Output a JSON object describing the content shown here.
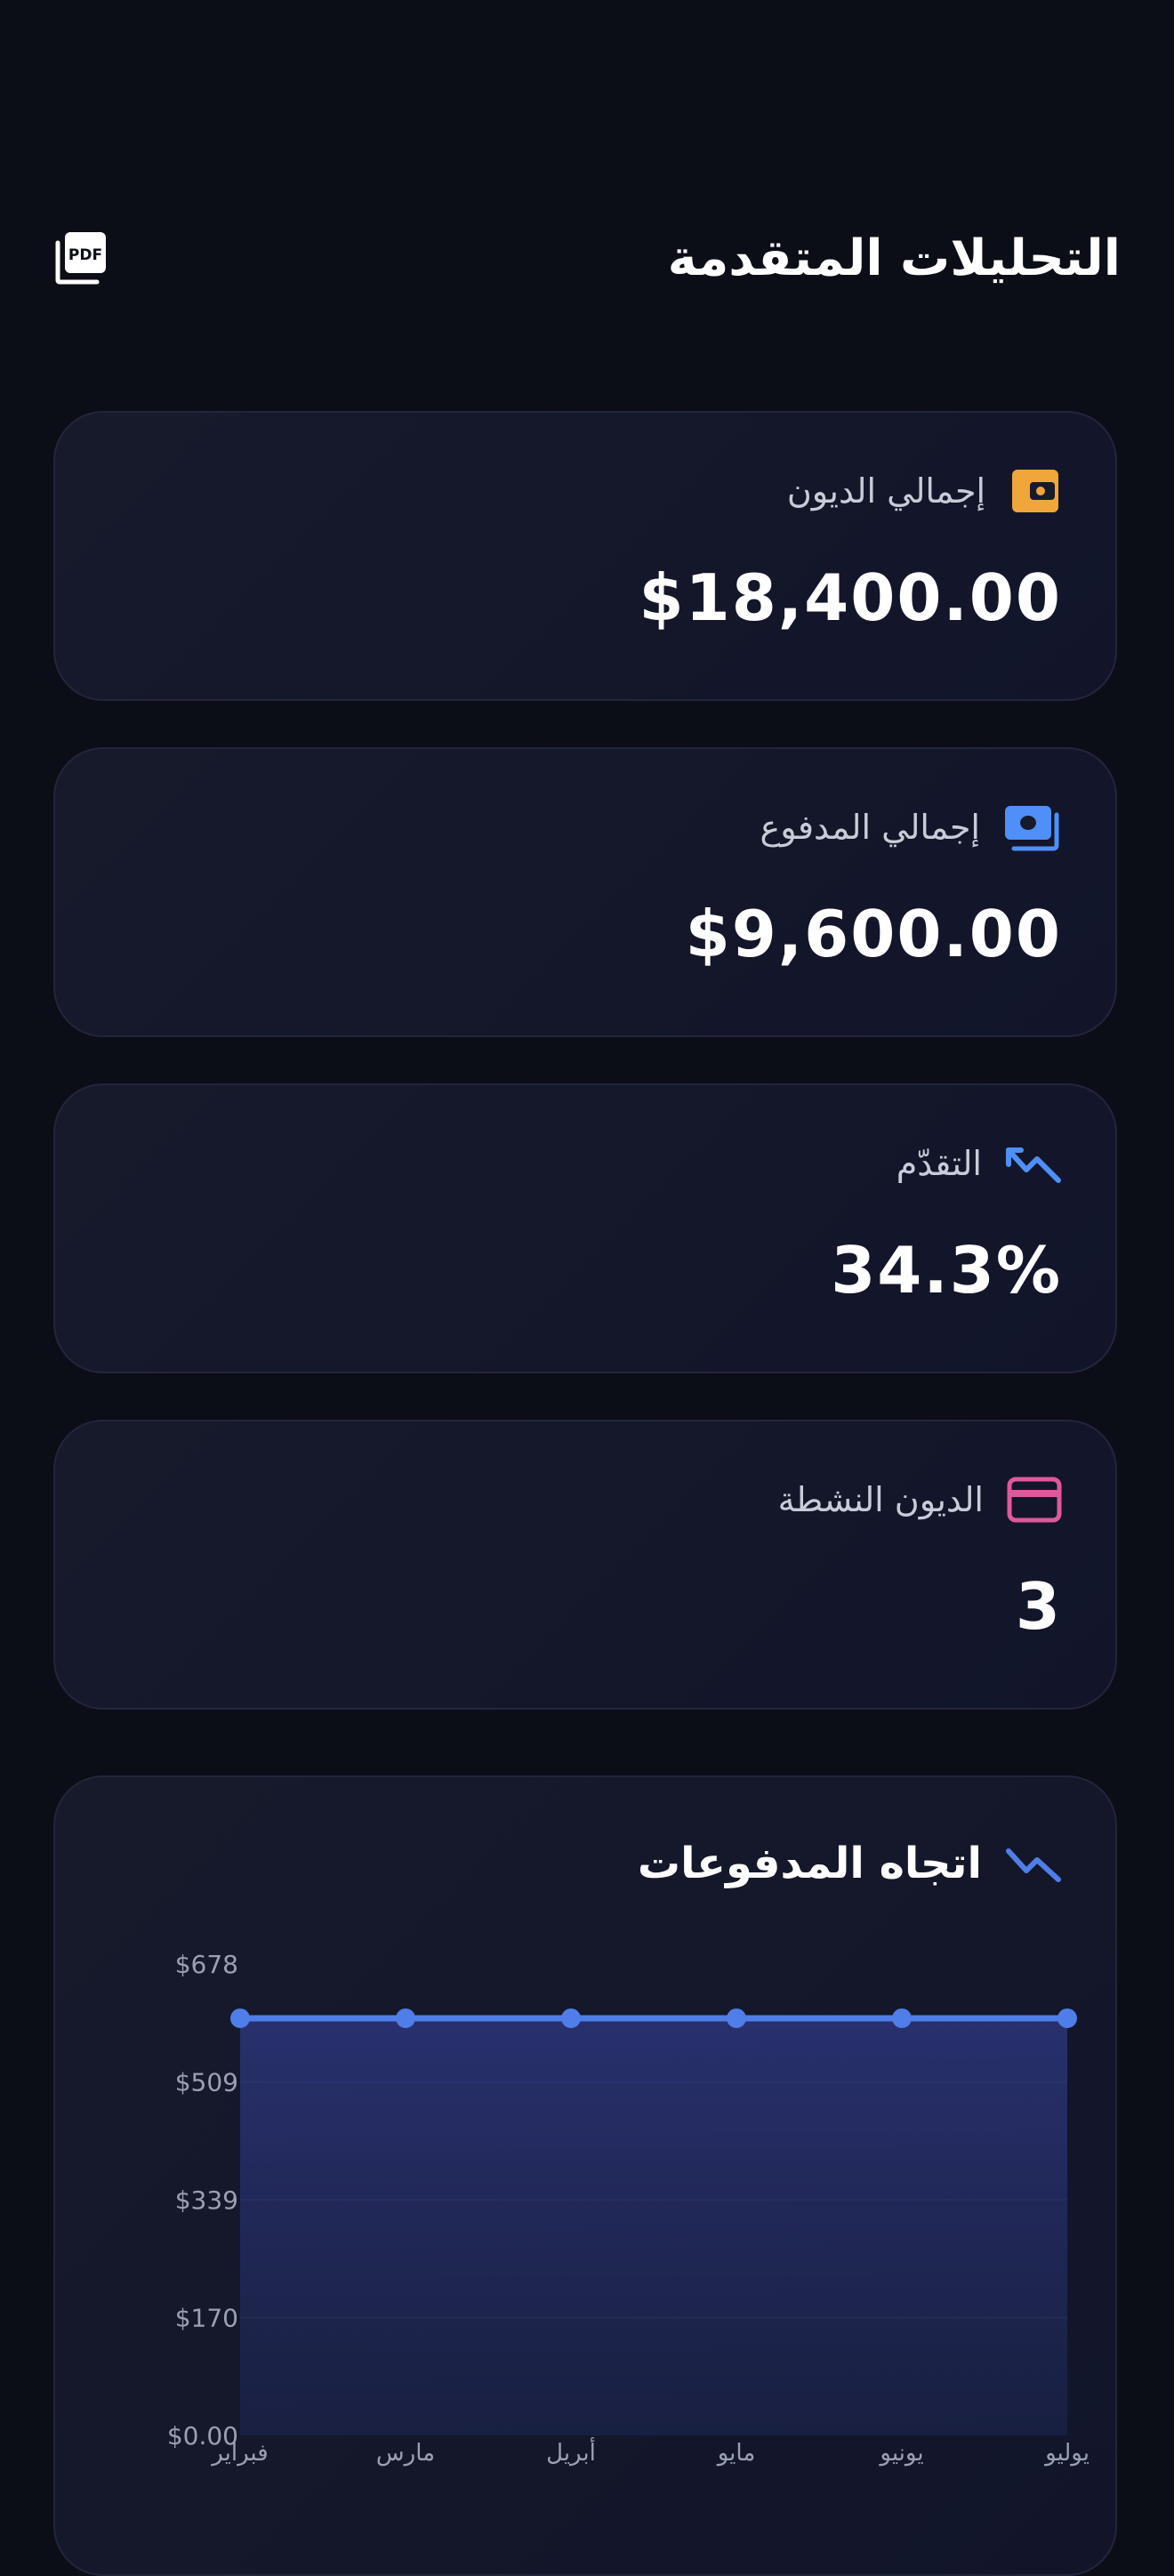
{
  "header": {
    "title": "التحليلات المتقدمة",
    "pdf_icon": "pdf-export-icon"
  },
  "stats": [
    {
      "label": "إجمالي الديون",
      "value": "$18,400.00",
      "icon": "wallet-icon",
      "color": "#f0a63a"
    },
    {
      "label": "إجمالي المدفوع",
      "value": "$9,600.00",
      "icon": "money-icon",
      "color": "#4f8ff7"
    },
    {
      "label": "التقدّم",
      "value": "34.3%",
      "icon": "trend-icon",
      "color": "#4f8ff7"
    },
    {
      "label": "الديون النشطة",
      "value": "3",
      "icon": "card-icon",
      "color": "#e0589c"
    }
  ],
  "chart_card": {
    "title": "اتجاه المدفوعات",
    "icon": "trend-icon",
    "color": "#4f8ff7"
  },
  "chart_data": {
    "type": "area",
    "title": "اتجاه المدفوعات",
    "categories": [
      "فبراير",
      "مارس",
      "أبريل",
      "مايو",
      "يونيو",
      "يوليو"
    ],
    "values": [
      600,
      600,
      600,
      600,
      600,
      600
    ],
    "y_ticks": [
      "$678",
      "$509",
      "$339",
      "$170",
      "$0.00"
    ],
    "ylim": [
      0,
      678
    ],
    "grid": true,
    "line_color": "#4f7ee8",
    "fill_color": "#2a3470"
  }
}
